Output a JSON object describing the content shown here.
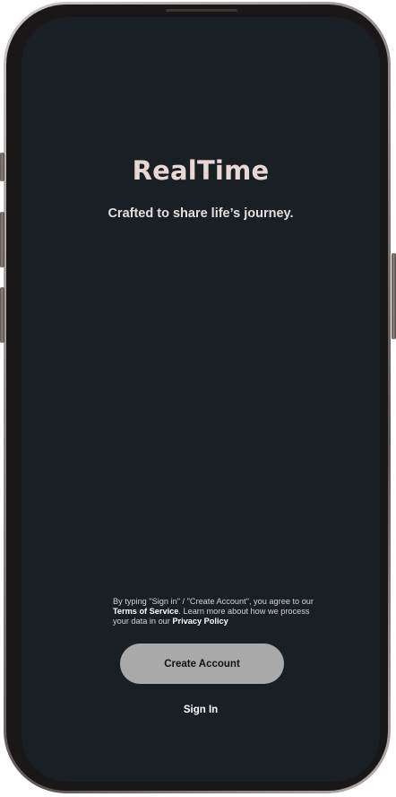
{
  "app": {
    "title": "RealTime",
    "tagline": "Crafted to share life’s journey."
  },
  "legal": {
    "part1": "By typing \"Sign in\" / \"Create Account\", you agree to our ",
    "terms_label": "Terms of Service",
    "part2": ". Learn more about how we process your data in our ",
    "privacy_label": "Privacy Policy"
  },
  "actions": {
    "create_account_label": "Create Account",
    "sign_in_label": "Sign In"
  },
  "colors": {
    "screen_background": "#1a1f24",
    "title_text": "#e7d7d5",
    "primary_button": "#a9a9a9"
  }
}
